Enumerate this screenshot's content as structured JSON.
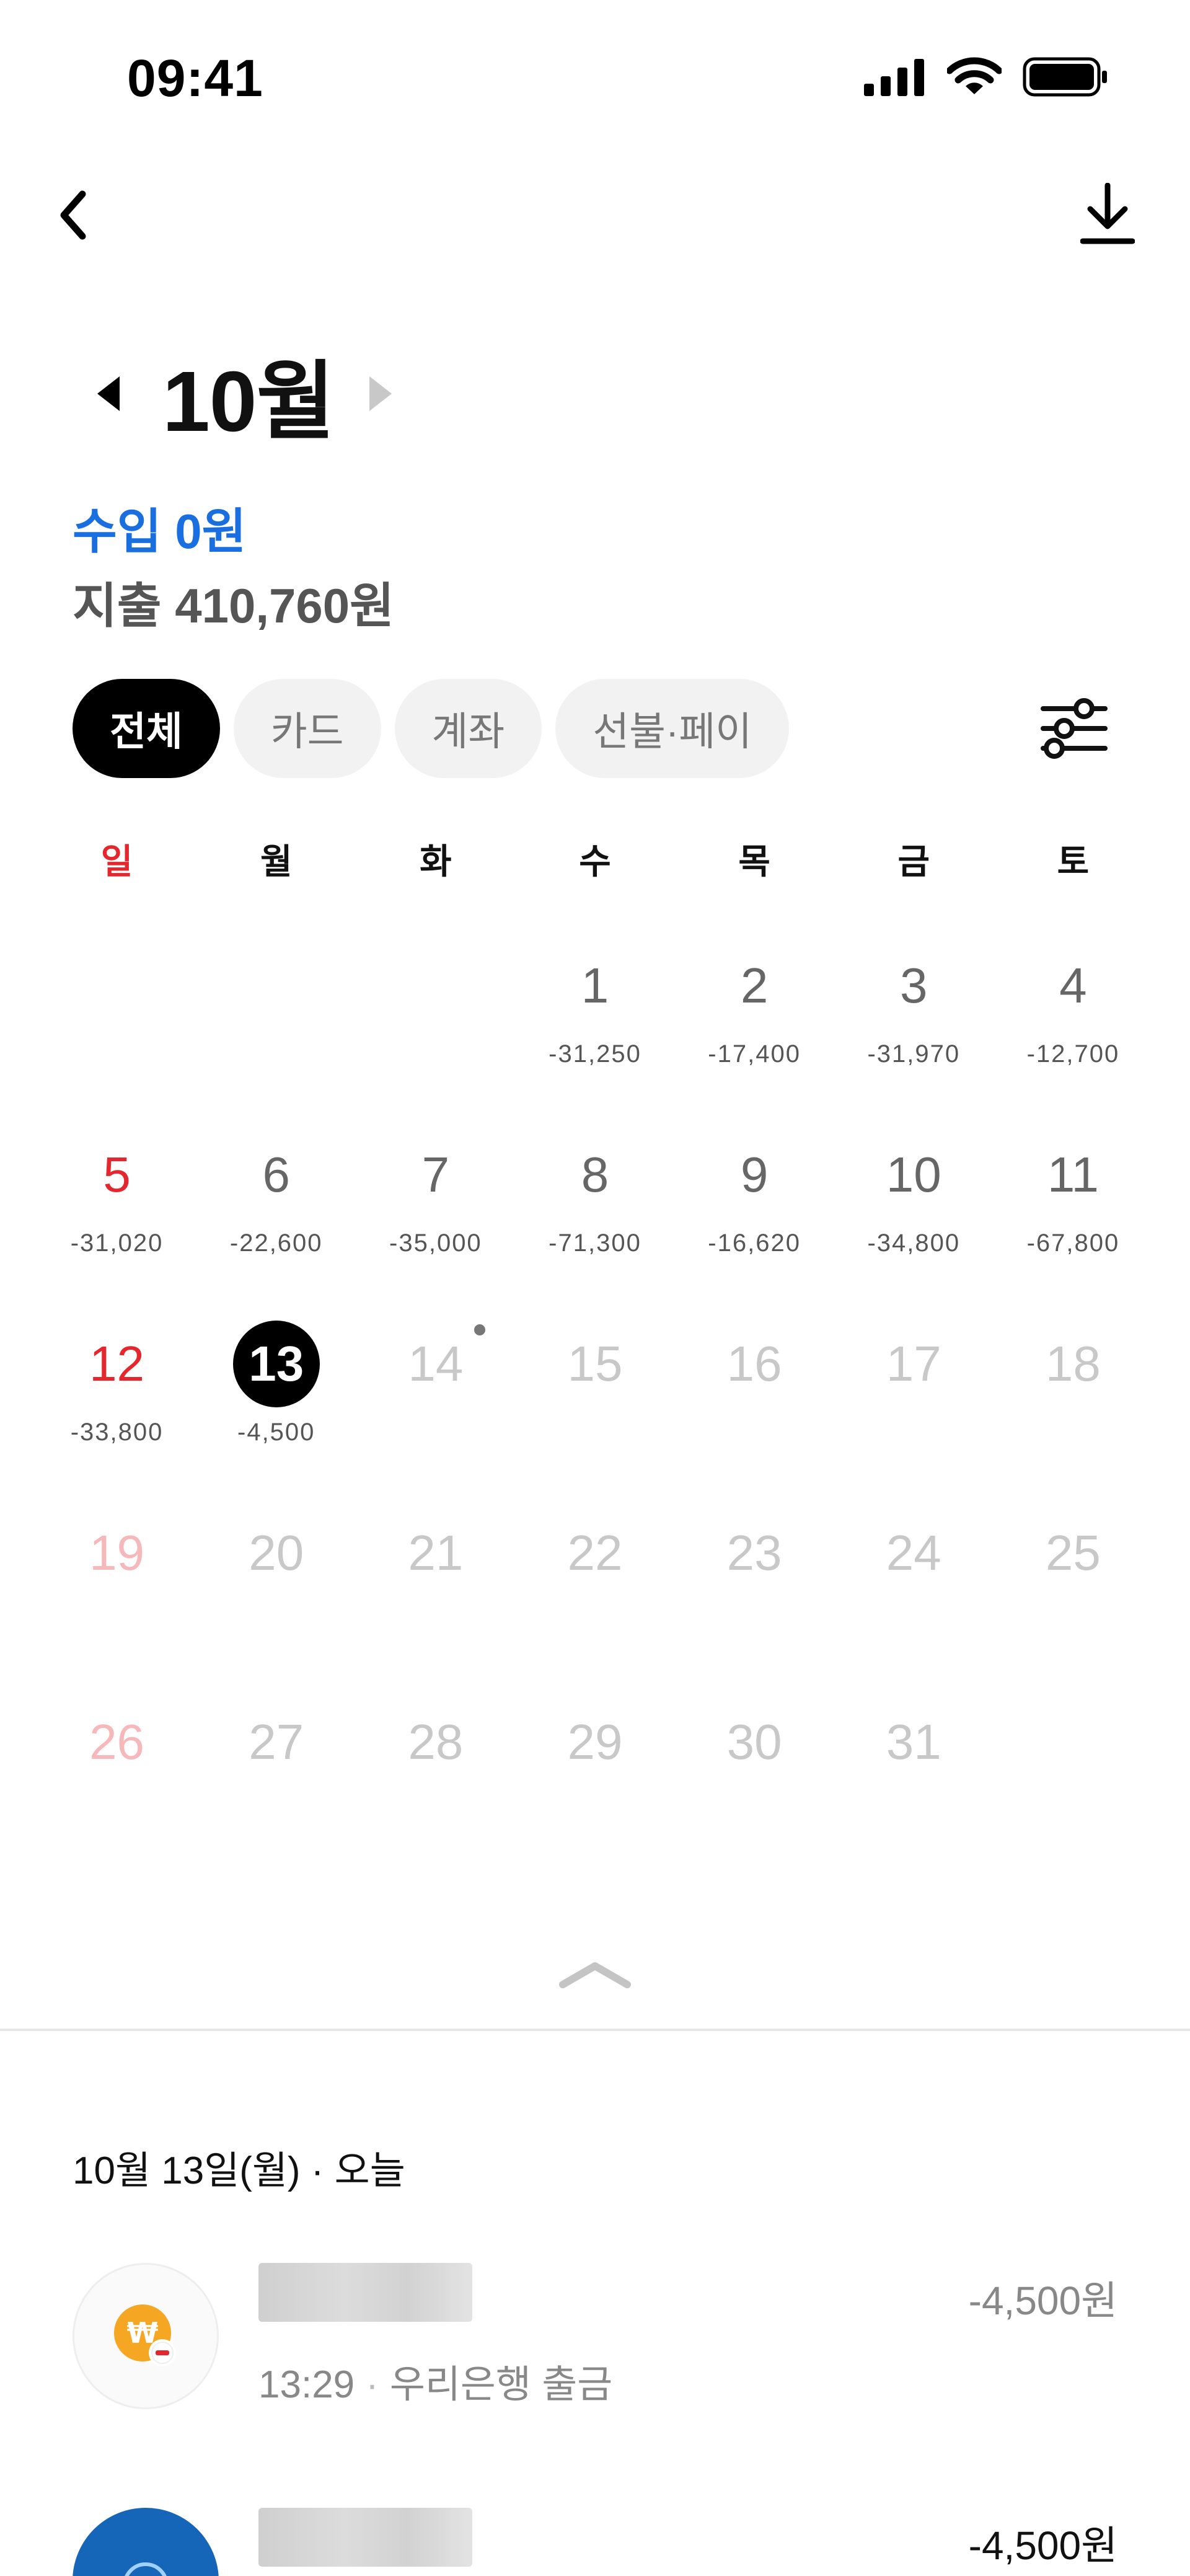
{
  "status_bar": {
    "time": "09:41",
    "icons": [
      "signal-icon",
      "wifi-icon",
      "battery-icon"
    ]
  },
  "nav": {
    "back_icon": "chevron-left-icon",
    "download_icon": "download-icon"
  },
  "month": {
    "title": "10월",
    "prev_icon": "triangle-left-icon",
    "next_icon": "triangle-right-icon"
  },
  "summary": {
    "income": "수입 0원",
    "expense": "지출 410,760원"
  },
  "chips": [
    {
      "label": "전체",
      "active": true
    },
    {
      "label": "카드",
      "active": false
    },
    {
      "label": "계좌",
      "active": false
    },
    {
      "label": "선불·페이",
      "active": false
    }
  ],
  "filter_icon": "sliders-icon",
  "weekdays": [
    "일",
    "월",
    "화",
    "수",
    "목",
    "금",
    "토"
  ],
  "calendar_days": [
    {
      "day": "",
      "amount": ""
    },
    {
      "day": "",
      "amount": ""
    },
    {
      "day": "",
      "amount": ""
    },
    {
      "day": "1",
      "amount": "-31,250"
    },
    {
      "day": "2",
      "amount": "-17,400"
    },
    {
      "day": "3",
      "amount": "-31,970"
    },
    {
      "day": "4",
      "amount": "-12,700"
    },
    {
      "day": "5",
      "amount": "-31,020"
    },
    {
      "day": "6",
      "amount": "-22,600"
    },
    {
      "day": "7",
      "amount": "-35,000"
    },
    {
      "day": "8",
      "amount": "-71,300"
    },
    {
      "day": "9",
      "amount": "-16,620"
    },
    {
      "day": "10",
      "amount": "-34,800"
    },
    {
      "day": "11",
      "amount": "-67,800"
    },
    {
      "day": "12",
      "amount": "-33,800"
    },
    {
      "day": "13",
      "amount": "-4,500",
      "today": true
    },
    {
      "day": "14",
      "amount": "",
      "future": true,
      "dot": true
    },
    {
      "day": "15",
      "amount": "",
      "future": true
    },
    {
      "day": "16",
      "amount": "",
      "future": true
    },
    {
      "day": "17",
      "amount": "",
      "future": true
    },
    {
      "day": "18",
      "amount": "",
      "future": true
    },
    {
      "day": "19",
      "amount": "",
      "future": true
    },
    {
      "day": "20",
      "amount": "",
      "future": true
    },
    {
      "day": "21",
      "amount": "",
      "future": true
    },
    {
      "day": "22",
      "amount": "",
      "future": true
    },
    {
      "day": "23",
      "amount": "",
      "future": true
    },
    {
      "day": "24",
      "amount": "",
      "future": true
    },
    {
      "day": "25",
      "amount": "",
      "future": true
    },
    {
      "day": "26",
      "amount": "",
      "future": true
    },
    {
      "day": "27",
      "amount": "",
      "future": true
    },
    {
      "day": "28",
      "amount": "",
      "future": true
    },
    {
      "day": "29",
      "amount": "",
      "future": true
    },
    {
      "day": "30",
      "amount": "",
      "future": true
    },
    {
      "day": "31",
      "amount": "",
      "future": true
    }
  ],
  "transactions": {
    "date_header": "10월 13일(월) · 오늘",
    "items": [
      {
        "time": "13:29",
        "detail": "우리은행 출금",
        "amount": "-4,500원",
        "icon": "won-withdraw-icon"
      },
      {
        "time": "",
        "detail": "",
        "amount": "-4,500원",
        "icon": "bank-logo-icon"
      }
    ]
  },
  "colors": {
    "income": "#1a6fe0",
    "sunday": "#e5262c",
    "accent_dark": "#000000"
  }
}
